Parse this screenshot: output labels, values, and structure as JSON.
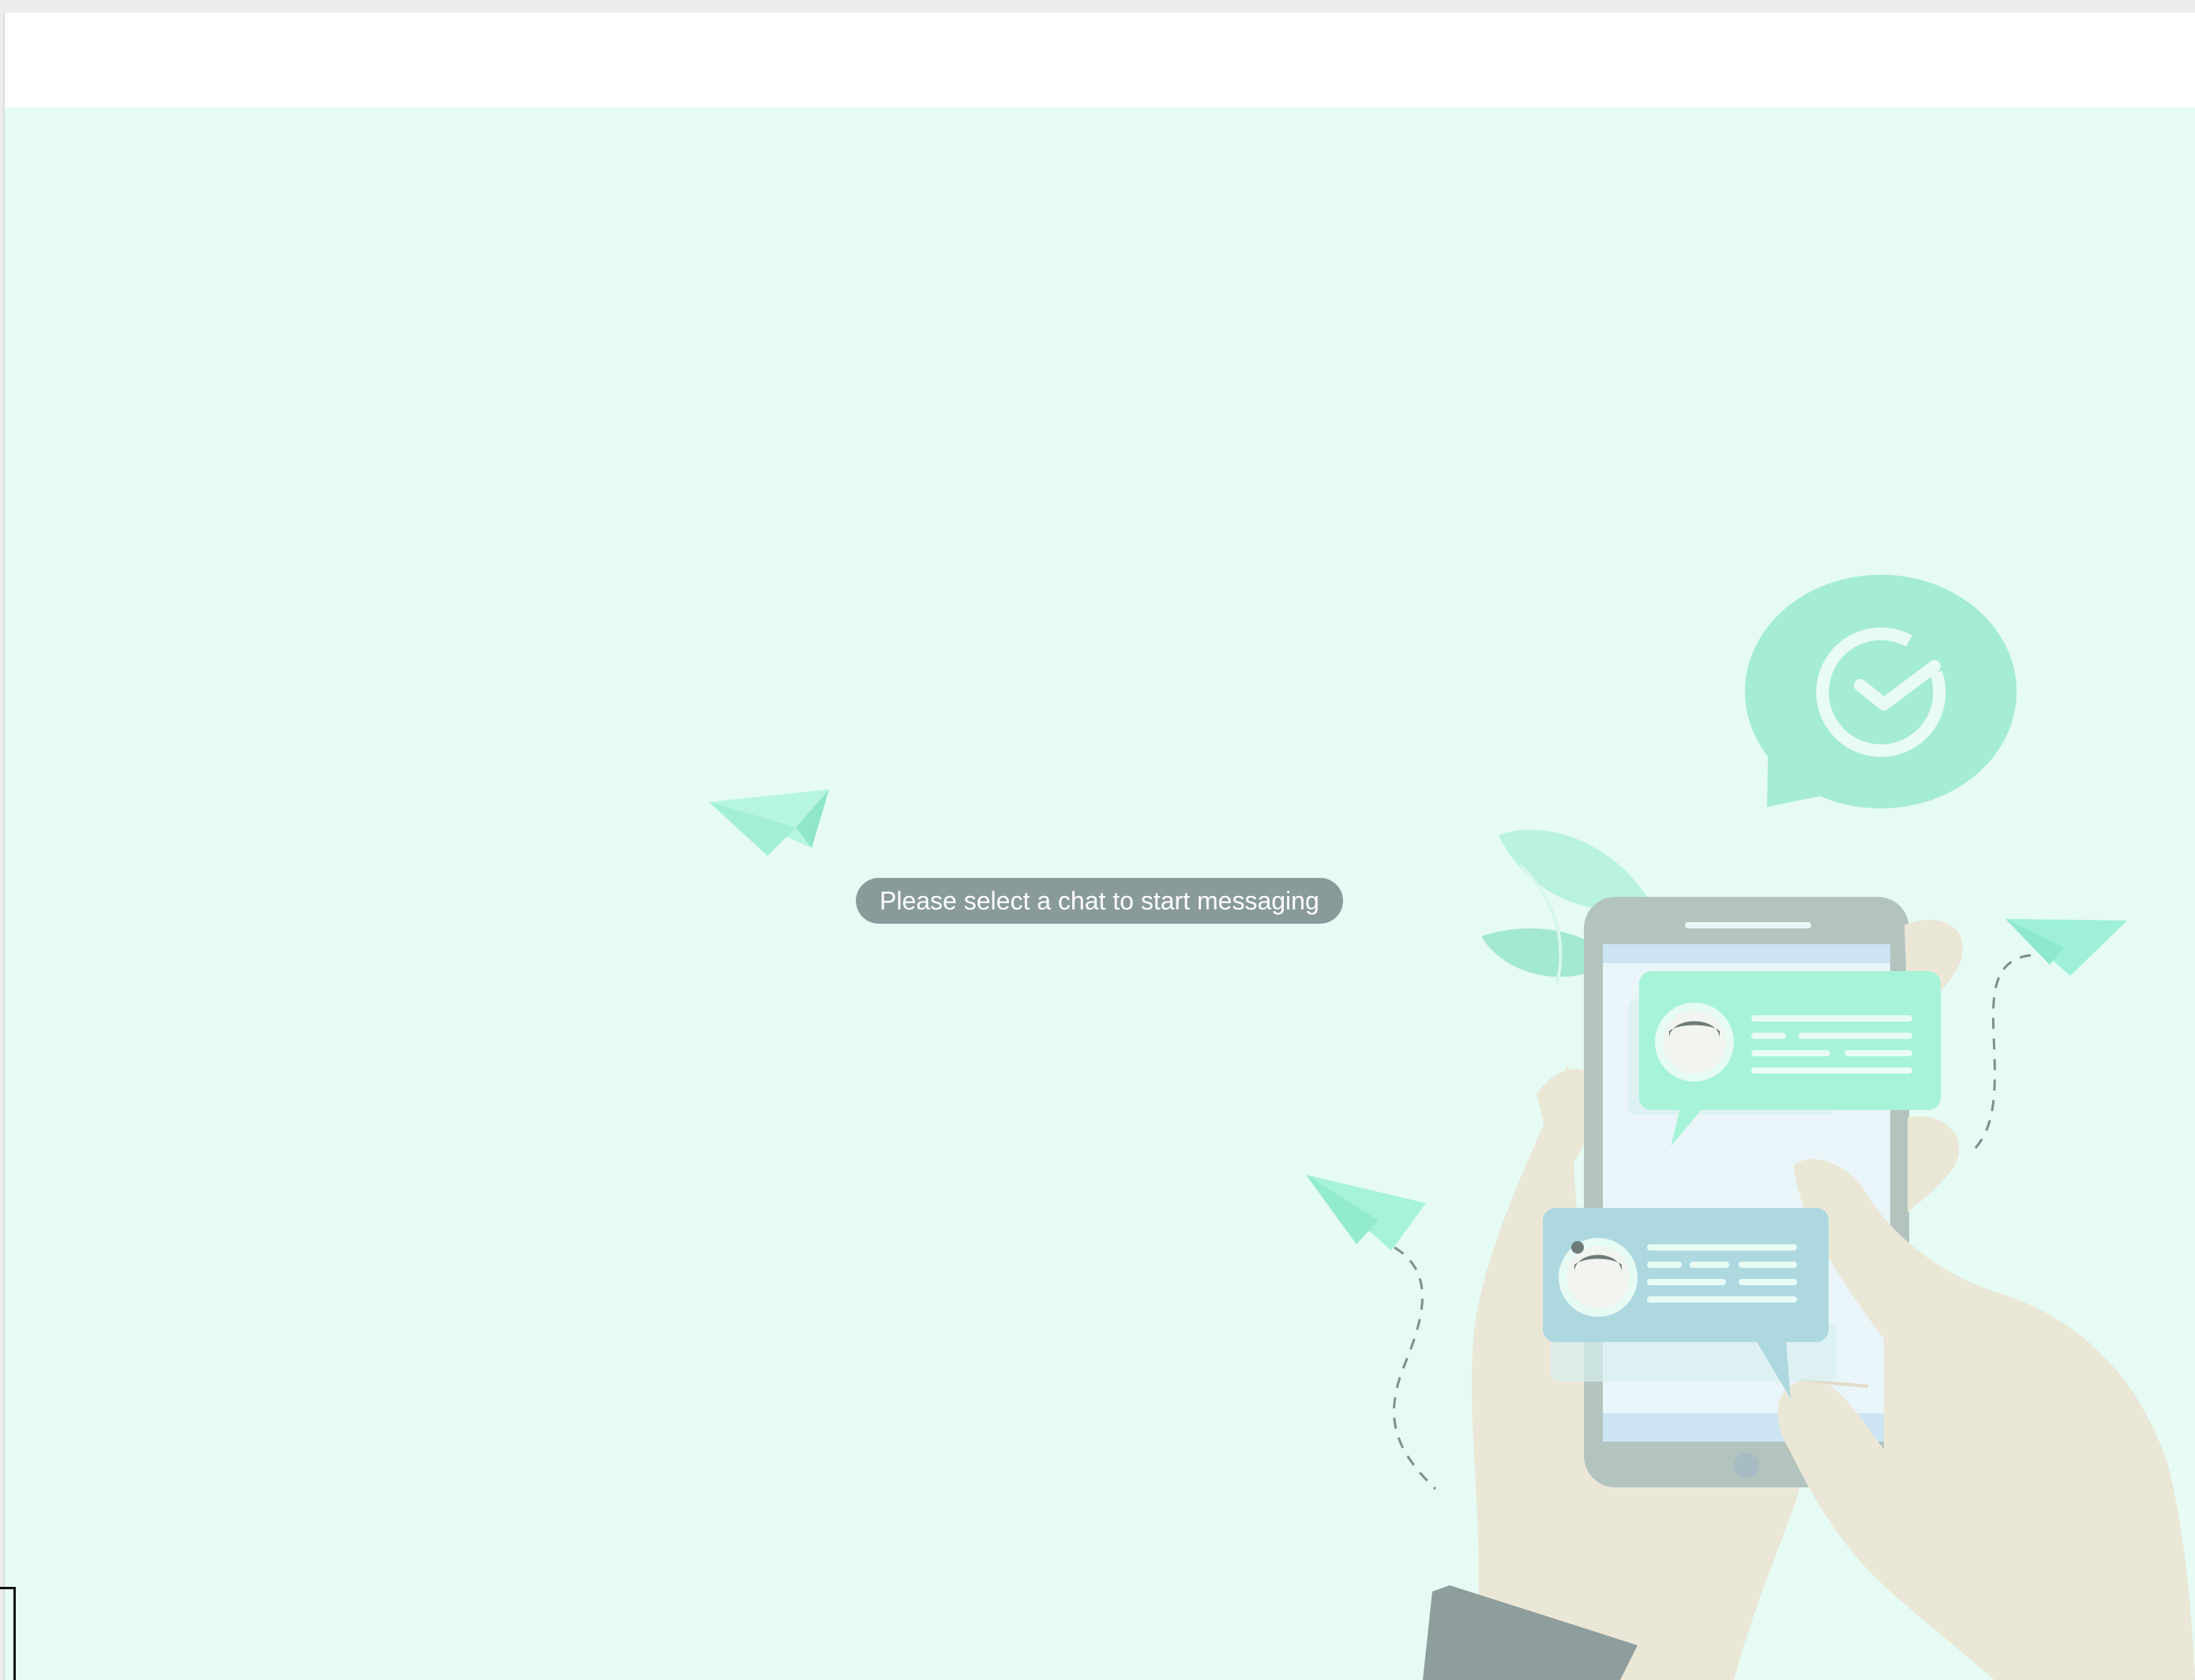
{
  "empty_state": {
    "message": "Please select a chat to start messaging"
  },
  "colors": {
    "chat_background": "#e5fbf4",
    "pill_background": "#899a9a",
    "accent_mint": "#a6f3d8",
    "accent_blue": "#add8e6",
    "skin": "#ece9da",
    "phone_frame": "#b0c4c0"
  },
  "icons": {
    "badge": "check-circle-icon",
    "plane": "paper-plane-icon"
  }
}
